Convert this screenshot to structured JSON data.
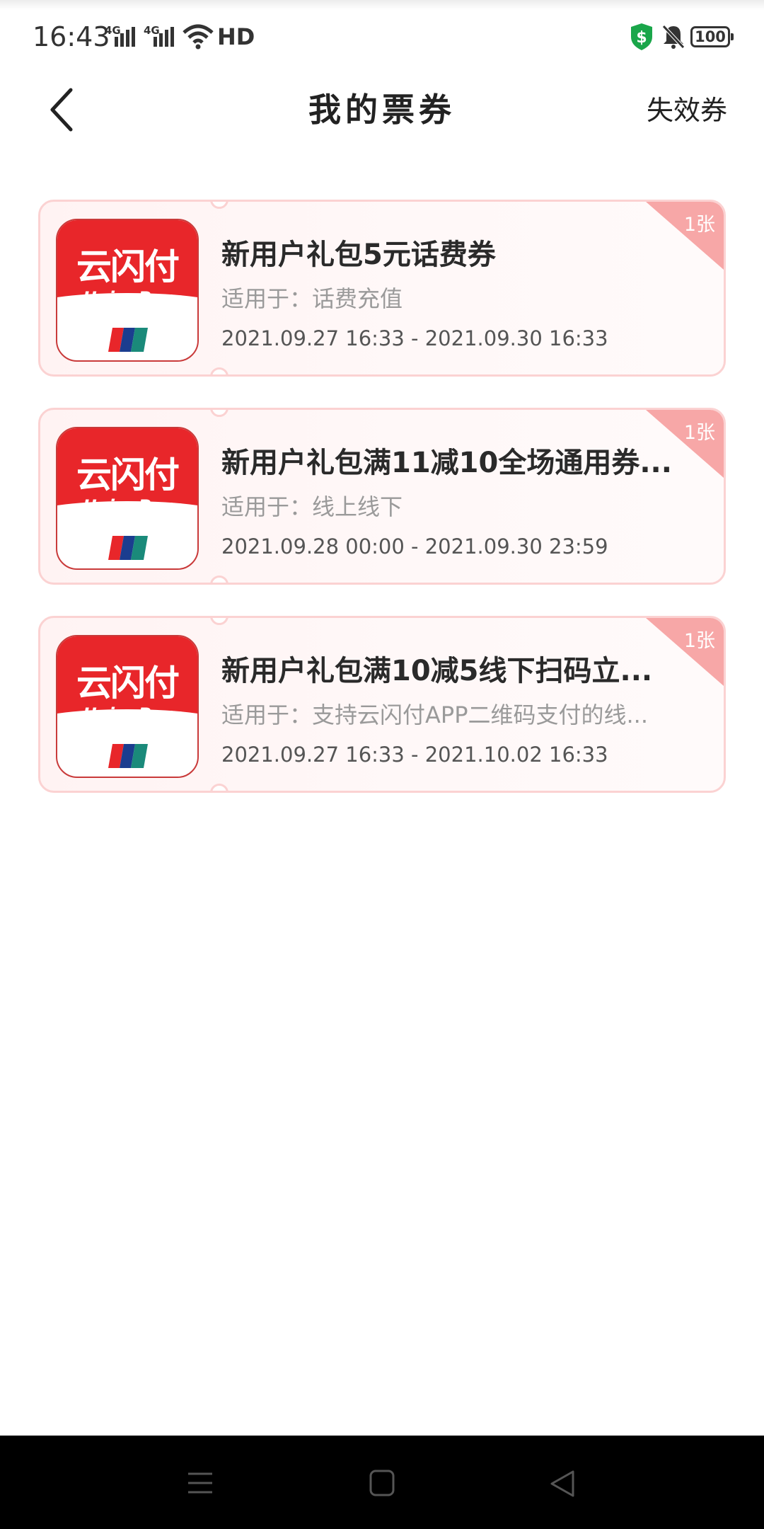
{
  "status_bar": {
    "time": "16:43",
    "network1": "4G",
    "network2": "4G",
    "hd": "HD",
    "battery": "100",
    "icons": [
      "signal-icon",
      "wifi-icon",
      "shield-icon",
      "bell-muted-icon",
      "battery-icon"
    ]
  },
  "header": {
    "title": "我的票券",
    "expired_link": "失效券",
    "back_icon": "chevron-left-icon"
  },
  "brand": {
    "logo_cn": "云闪付",
    "logo_en": "UnionPay"
  },
  "coupons": [
    {
      "title": "新用户礼包5元话费券",
      "scope": "适用于：话费充值",
      "date_range": "2021.09.27 16:33 - 2021.09.30 16:33",
      "count": "1张"
    },
    {
      "title": "新用户礼包满11减10全场通用券...",
      "scope": "适用于：线上线下",
      "date_range": "2021.09.28 00:00 - 2021.09.30 23:59",
      "count": "1张"
    },
    {
      "title": "新用户礼包满10减5线下扫码立...",
      "scope": "适用于：支持云闪付APP二维码支付的线...",
      "date_range": "2021.09.27 16:33 - 2021.10.02 16:33",
      "count": "1张"
    }
  ],
  "colors": {
    "brand_red": "#e8262a",
    "card_border": "#fbd2d2",
    "badge_pink": "#f7a7a7"
  }
}
